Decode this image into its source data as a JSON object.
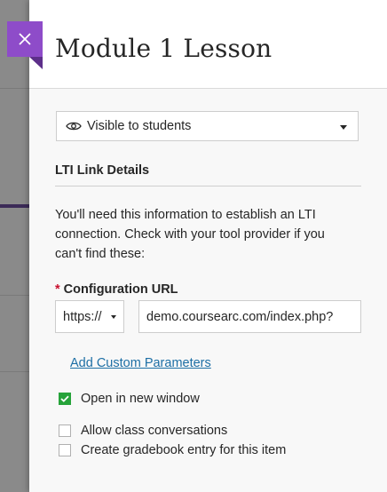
{
  "panel": {
    "title": "Module 1 Lesson",
    "close_icon": "close-icon",
    "accent_color": "#8e4cc9"
  },
  "visibility": {
    "icon": "eye-icon",
    "selected": "Visible to students"
  },
  "lti": {
    "heading": "LTI Link Details",
    "description_lines": [
      "You'll need this information to establish an LTI",
      "connection. Check with your tool provider if you",
      "can't find these:"
    ],
    "config_url": {
      "required_marker": "*",
      "label": "Configuration URL",
      "protocol": "https://",
      "value": "demo.coursearc.com/index.php?"
    },
    "custom_params_link": "Add Custom Parameters"
  },
  "options": [
    {
      "label": "Open in new window",
      "checked": true
    },
    {
      "label": "Allow class conversations",
      "checked": false
    },
    {
      "label": "Create gradebook entry for this item",
      "checked": false
    }
  ]
}
